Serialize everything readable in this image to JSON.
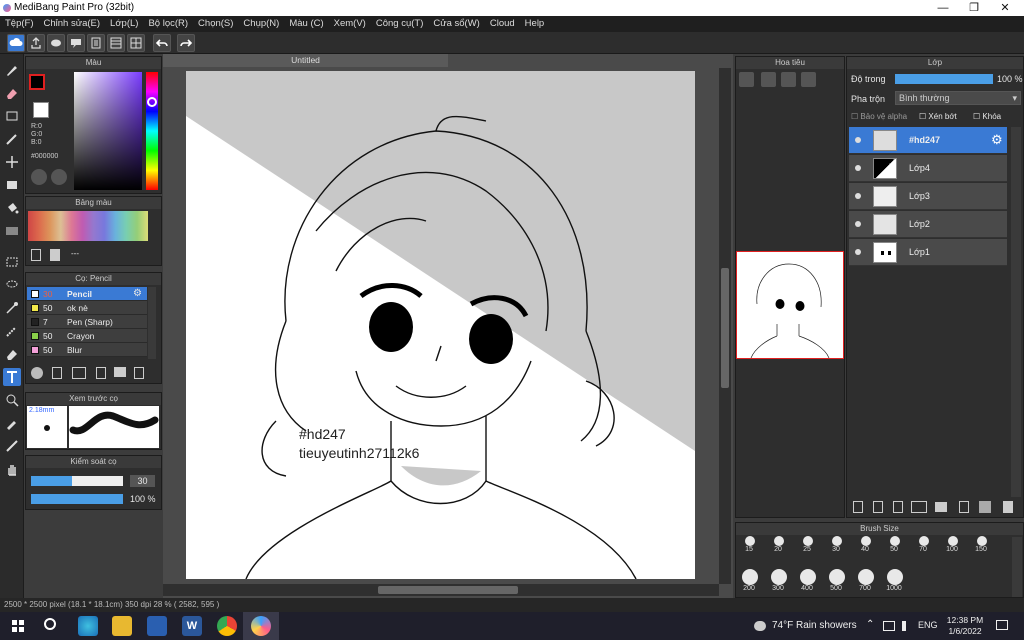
{
  "window": {
    "title": "MediBang Paint Pro (32bit)"
  },
  "menu": [
    "Tệp(F)",
    "Chỉnh sửa(E)",
    "Lớp(L)",
    "Bộ lọc(R)",
    "Chọn(S)",
    "Chụp(N)",
    "Màu (C)",
    "Xem(V)",
    "Công cụ(T)",
    "Cửa sổ(W)",
    "Cloud",
    "Help"
  ],
  "color_panel": {
    "title": "Màu",
    "r": "R:0",
    "g": "G:0",
    "b": "B:0",
    "hex": "#000000"
  },
  "palette_panel": {
    "title": "Bảng màu",
    "more": "---"
  },
  "brush_panel": {
    "title": "Cọ: Pencil",
    "brushes": [
      {
        "size": "30",
        "name": "Pencil",
        "color": "#ffffff",
        "selected": true
      },
      {
        "size": "50",
        "name": "ok nè",
        "color": "#f2e84a"
      },
      {
        "size": "7",
        "name": "Pen (Sharp)",
        "color": "#222222"
      },
      {
        "size": "50",
        "name": "Crayon",
        "color": "#8ad04a"
      },
      {
        "size": "50",
        "name": "Blur",
        "color": "#f3a0d8"
      }
    ]
  },
  "preview_panel": {
    "title": "Xem trước cọ",
    "size": "2.18mm"
  },
  "control_panel": {
    "title": "Kiểm soát cọ",
    "size_value": "30",
    "size_fraction": 0.45,
    "opacity_value": "100 %",
    "opacity_fraction": 1.0
  },
  "canvas": {
    "tab": "Untitled",
    "text_line1": "#hd247",
    "text_line2": "tieuyeutinh27112k6"
  },
  "navigator": {
    "title": "Hoa tiêu"
  },
  "layers_panel": {
    "title": "Lớp",
    "opacity_label": "Độ trong",
    "opacity_value": "100 %",
    "opacity_fraction": 1.0,
    "blend_label": "Pha trộn",
    "blend_value": "Bình thường",
    "protect_alpha": "Bảo vệ alpha",
    "clipping": "Xén bớt",
    "lock": "Khóa",
    "layers": [
      {
        "name": "#hd247",
        "selected": true
      },
      {
        "name": "Lớp4"
      },
      {
        "name": "Lớp3"
      },
      {
        "name": "Lớp2"
      },
      {
        "name": "Lớp1"
      }
    ]
  },
  "brush_size_panel": {
    "title": "Brush Size",
    "sizes": [
      "15",
      "20",
      "25",
      "30",
      "40",
      "50",
      "70",
      "100",
      "150",
      "200",
      "300",
      "400",
      "500",
      "700",
      "1000"
    ]
  },
  "status": "2500 * 2500 pixel   (18.1 * 18.1cm)   350 dpi   28 %   ( 2582, 595 )",
  "taskbar": {
    "weather": "74°F  Rain showers",
    "lang": "ENG",
    "time": "12:38 PM",
    "date": "1/6/2022"
  },
  "colors": {
    "accent": "#3a7ad4",
    "primary_color": "#000000"
  }
}
